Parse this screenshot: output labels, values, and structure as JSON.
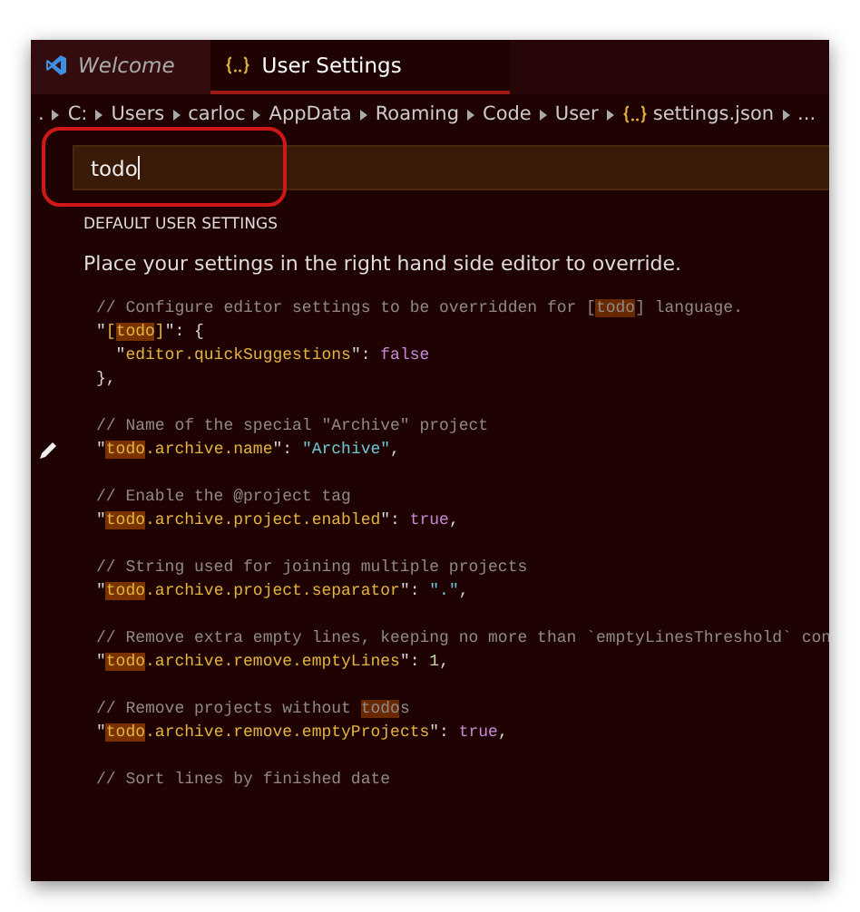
{
  "tabs": [
    {
      "label": "Welcome",
      "kind": "app",
      "selected": false
    },
    {
      "label": "User Settings",
      "kind": "json",
      "selected": true
    }
  ],
  "breadcrumb": [
    {
      "label": ".",
      "kind": "path"
    },
    {
      "label": "C:",
      "kind": "path"
    },
    {
      "label": "Users",
      "kind": "path"
    },
    {
      "label": "carloc",
      "kind": "path"
    },
    {
      "label": "AppData",
      "kind": "path"
    },
    {
      "label": "Roaming",
      "kind": "path"
    },
    {
      "label": "Code",
      "kind": "path"
    },
    {
      "label": "User",
      "kind": "path"
    },
    {
      "label": "settings.json",
      "kind": "json"
    },
    {
      "label": "...",
      "kind": "path"
    }
  ],
  "search": {
    "value": "todo"
  },
  "heading": "DEFAULT USER SETTINGS",
  "description": "Place your settings in the right hand side editor to override.",
  "code_blocks": [
    {
      "lines": [
        {
          "edited": false,
          "tokens": [
            {
              "kind": "comment",
              "text": "// Configure editor settings to be overridden for ["
            },
            {
              "kind": "comment-match",
              "text": "todo"
            },
            {
              "kind": "comment",
              "text": "] language."
            }
          ]
        },
        {
          "edited": false,
          "tokens": [
            {
              "kind": "punct",
              "text": "\""
            },
            {
              "kind": "key",
              "text": "["
            },
            {
              "kind": "match",
              "text": "todo"
            },
            {
              "kind": "key",
              "text": "]"
            },
            {
              "kind": "punct",
              "text": "\": {"
            }
          ]
        },
        {
          "edited": false,
          "tokens": [
            {
              "kind": "punct",
              "text": "  \""
            },
            {
              "kind": "key",
              "text": "editor.quickSuggestions"
            },
            {
              "kind": "punct",
              "text": "\": "
            },
            {
              "kind": "bool",
              "text": "false"
            }
          ]
        },
        {
          "edited": false,
          "tokens": [
            {
              "kind": "punct",
              "text": "},"
            }
          ]
        }
      ]
    },
    {
      "lines": [
        {
          "edited": false,
          "tokens": [
            {
              "kind": "comment",
              "text": "// Name of the special \"Archive\" project"
            }
          ]
        },
        {
          "edited": true,
          "tokens": [
            {
              "kind": "punct",
              "text": "\""
            },
            {
              "kind": "match",
              "text": "todo"
            },
            {
              "kind": "key",
              "text": ".archive.name"
            },
            {
              "kind": "punct",
              "text": "\": "
            },
            {
              "kind": "str",
              "text": "\"Archive\""
            },
            {
              "kind": "punct",
              "text": ","
            }
          ]
        }
      ]
    },
    {
      "lines": [
        {
          "edited": false,
          "tokens": [
            {
              "kind": "comment",
              "text": "// Enable the @project tag"
            }
          ]
        },
        {
          "edited": false,
          "tokens": [
            {
              "kind": "punct",
              "text": "\""
            },
            {
              "kind": "match",
              "text": "todo"
            },
            {
              "kind": "key",
              "text": ".archive.project.enabled"
            },
            {
              "kind": "punct",
              "text": "\": "
            },
            {
              "kind": "bool",
              "text": "true"
            },
            {
              "kind": "punct",
              "text": ","
            }
          ]
        }
      ]
    },
    {
      "lines": [
        {
          "edited": false,
          "tokens": [
            {
              "kind": "comment",
              "text": "// String used for joining multiple projects"
            }
          ]
        },
        {
          "edited": false,
          "tokens": [
            {
              "kind": "punct",
              "text": "\""
            },
            {
              "kind": "match",
              "text": "todo"
            },
            {
              "kind": "key",
              "text": ".archive.project.separator"
            },
            {
              "kind": "punct",
              "text": "\": "
            },
            {
              "kind": "str",
              "text": "\".\""
            },
            {
              "kind": "punct",
              "text": ","
            }
          ]
        }
      ]
    },
    {
      "lines": [
        {
          "edited": false,
          "tokens": [
            {
              "kind": "comment",
              "text": "// Remove extra empty lines, keeping no more than `emptyLinesThreshold` con"
            }
          ]
        },
        {
          "edited": false,
          "tokens": [
            {
              "kind": "punct",
              "text": "\""
            },
            {
              "kind": "match",
              "text": "todo"
            },
            {
              "kind": "key",
              "text": ".archive.remove.emptyLines"
            },
            {
              "kind": "punct",
              "text": "\": "
            },
            {
              "kind": "num",
              "text": "1"
            },
            {
              "kind": "punct",
              "text": ","
            }
          ]
        }
      ]
    },
    {
      "lines": [
        {
          "edited": false,
          "tokens": [
            {
              "kind": "comment",
              "text": "// Remove projects without "
            },
            {
              "kind": "comment-match",
              "text": "todo"
            },
            {
              "kind": "comment",
              "text": "s"
            }
          ]
        },
        {
          "edited": false,
          "tokens": [
            {
              "kind": "punct",
              "text": "\""
            },
            {
              "kind": "match",
              "text": "todo"
            },
            {
              "kind": "key",
              "text": ".archive.remove.emptyProjects"
            },
            {
              "kind": "punct",
              "text": "\": "
            },
            {
              "kind": "bool",
              "text": "true"
            },
            {
              "kind": "punct",
              "text": ","
            }
          ]
        }
      ]
    },
    {
      "lines": [
        {
          "edited": false,
          "tokens": [
            {
              "kind": "comment",
              "text": "// Sort lines by finished date"
            }
          ]
        }
      ]
    }
  ]
}
